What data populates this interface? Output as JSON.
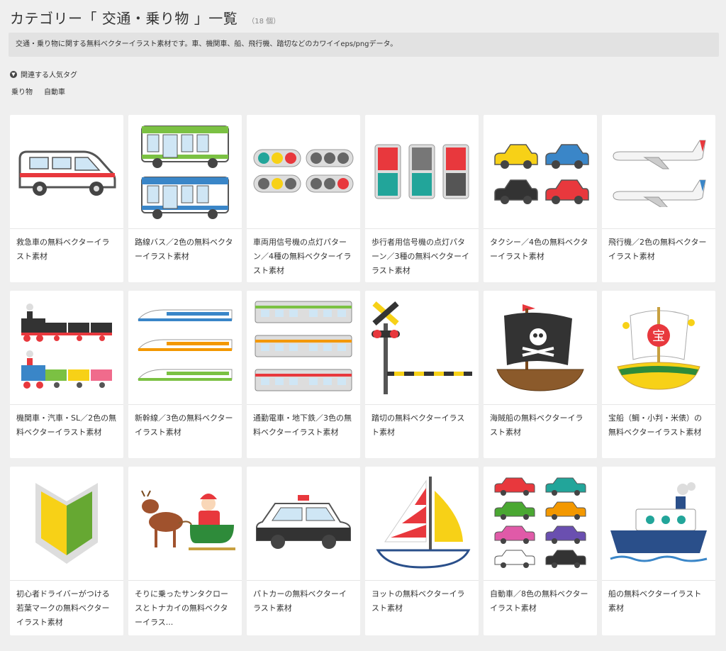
{
  "header": {
    "title": "カテゴリー「 交通・乗り物 」一覧",
    "count": "（18 個）"
  },
  "description": "交通・乗り物に関する無料ベクターイラスト素材です。車、機関車、船、飛行機、踏切などのカワイイeps/pngデータ。",
  "tags": {
    "heading_icon": "chevron-down-icon",
    "heading": "関連する人気タグ",
    "items": [
      "乗り物",
      "自動車"
    ]
  },
  "items": [
    {
      "title": "救急車の無料ベクターイラスト素材",
      "icon": "ambulance"
    },
    {
      "title": "路線バス／2色の無料ベクターイラスト素材",
      "icon": "bus"
    },
    {
      "title": "車両用信号機の点灯パターン／4種の無料ベクターイラスト素材",
      "icon": "traffic-light"
    },
    {
      "title": "歩行者用信号機の点灯パターン／3種の無料ベクターイラスト素材",
      "icon": "pedestrian-signal"
    },
    {
      "title": "タクシー／4色の無料ベクターイラスト素材",
      "icon": "taxi"
    },
    {
      "title": "飛行機／2色の無料ベクターイラスト素材",
      "icon": "airplane"
    },
    {
      "title": "機関車・汽車・SL／2色の無料ベクターイラスト素材",
      "icon": "steam-locomotive"
    },
    {
      "title": "新幹線／3色の無料ベクターイラスト素材",
      "icon": "shinkansen"
    },
    {
      "title": "通勤電車・地下鉄／3色の無料ベクターイラスト素材",
      "icon": "commuter-train"
    },
    {
      "title": "踏切の無料ベクターイラスト素材",
      "icon": "railroad-crossing"
    },
    {
      "title": "海賊船の無料ベクターイラスト素材",
      "icon": "pirate-ship"
    },
    {
      "title": "宝船（鯛・小判・米俵）の無料ベクターイラスト素材",
      "icon": "treasure-ship",
      "mark": "宝"
    },
    {
      "title": "初心者ドライバーがつける若葉マークの無料ベクターイラスト素材",
      "icon": "beginner-mark"
    },
    {
      "title": "そりに乗ったサンタクロースとトナカイの無料ベクターイラス...",
      "icon": "santa-sleigh"
    },
    {
      "title": "パトカーの無料ベクターイラスト素材",
      "icon": "police-car"
    },
    {
      "title": "ヨットの無料ベクターイラスト素材",
      "icon": "sailboat"
    },
    {
      "title": "自動車／8色の無料ベクターイラスト素材",
      "icon": "cars"
    },
    {
      "title": "船の無料ベクターイラスト素材",
      "icon": "ship"
    }
  ]
}
